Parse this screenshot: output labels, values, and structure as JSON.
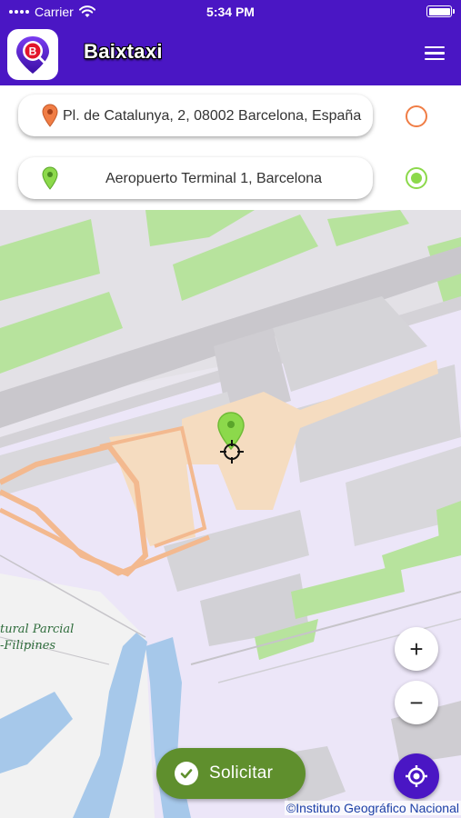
{
  "status_bar": {
    "carrier": "Carrier",
    "time": "5:34 PM",
    "icons": [
      "signal-dots-icon",
      "wifi-icon",
      "battery-icon"
    ]
  },
  "app_bar": {
    "title": "Baixtaxi",
    "logo_letter": "B",
    "menu_icon": "hamburger-menu-icon",
    "background_color": "#4a16c4"
  },
  "addresses": {
    "origin": {
      "text": "Pl. de Catalunya, 2, 08002 Barcelona, España",
      "pin_color": "#f07d45",
      "selected": false
    },
    "destination": {
      "text": "Aeropuerto Terminal 1, Barcelona",
      "pin_color": "#8cd94b",
      "selected": true
    }
  },
  "map": {
    "labels": {
      "park_line1": "tural Parcial",
      "park_line2": "-Filipines"
    },
    "attribution": "©Instituto Geográfico Nacional",
    "zoom_in": "+",
    "zoom_out": "−"
  },
  "actions": {
    "request_label": "Solicitar",
    "request_color": "#5f8f2d",
    "locate_icon": "my-location-icon"
  }
}
